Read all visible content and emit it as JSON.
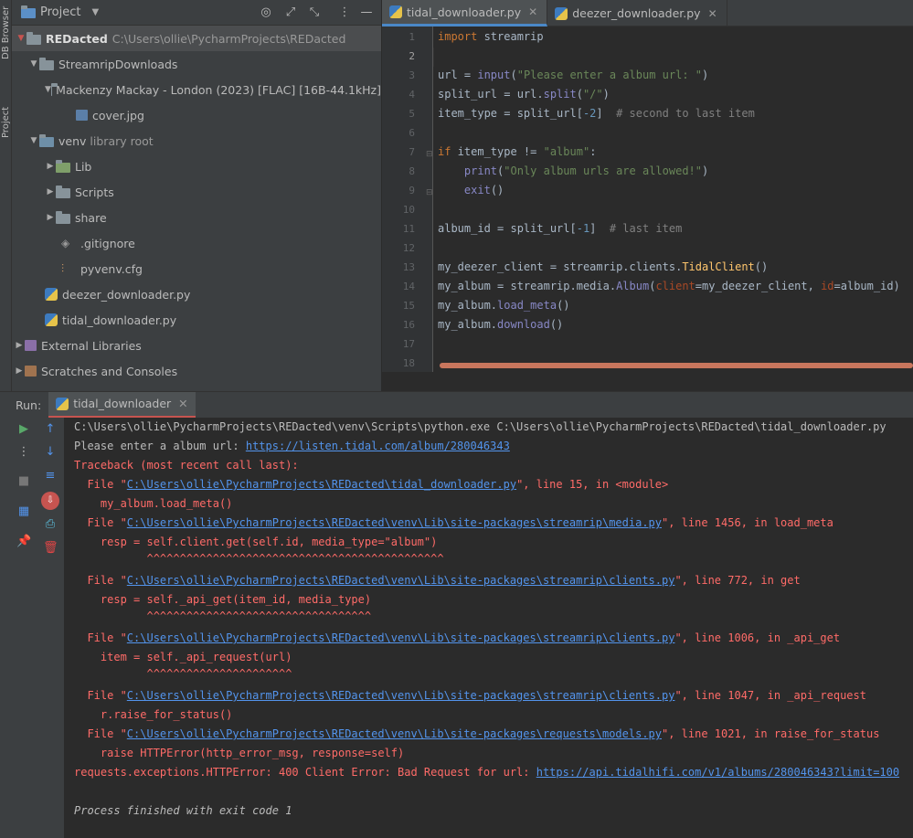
{
  "side_tabs": {
    "db_browser": "DB Browser",
    "project": "Project"
  },
  "project_panel": {
    "title": "Project"
  },
  "tree": {
    "root_name": "REDacted",
    "root_path": "C:\\Users\\ollie\\PycharmProjects\\REDacted",
    "streamrip": "StreamripDownloads",
    "album": "Mackenzy Mackay - London (2023) [FLAC] [16B-44.1kHz]",
    "cover": "cover.jpg",
    "venv": "venv",
    "venv_note": "library root",
    "lib": "Lib",
    "scripts": "Scripts",
    "share": "share",
    "gitignore": ".gitignore",
    "pyvenv": "pyvenv.cfg",
    "deezer": "deezer_downloader.py",
    "tidal": "tidal_downloader.py",
    "ext": "External Libraries",
    "scratch": "Scratches and Consoles"
  },
  "tabs": {
    "t1": "tidal_downloader.py",
    "t2": "deezer_downloader.py"
  },
  "line_numbers": [
    "1",
    "2",
    "3",
    "4",
    "5",
    "6",
    "7",
    "8",
    "9",
    "10",
    "11",
    "12",
    "13",
    "14",
    "15",
    "16",
    "17",
    "18"
  ],
  "code": {
    "l1a": "import",
    "l1b": " streamrip",
    "l3a": "url = ",
    "l3b": "input",
    "l3c": "(",
    "l3d": "\"Please enter a album url: \"",
    "l3e": ")",
    "l4a": "split_url = url.",
    "l4b": "split",
    "l4c": "(",
    "l4d": "\"/\"",
    "l4e": ")",
    "l5a": "item_type = split_url[",
    "l5b": "-2",
    "l5c": "]  ",
    "l5d": "# second to last item",
    "l7a": "if",
    "l7b": " item_type != ",
    "l7c": "\"album\"",
    "l7d": ":",
    "l8a": "    ",
    "l8b": "print",
    "l8c": "(",
    "l8d": "\"Only album urls are allowed!\"",
    "l8e": ")",
    "l9a": "    ",
    "l9b": "exit",
    "l9c": "()",
    "l11a": "album_id = split_url[",
    "l11b": "-1",
    "l11c": "]  ",
    "l11d": "# last item",
    "l13a": "my_deezer_client = streamrip.clients.",
    "l13b": "TidalClient",
    "l13c": "()",
    "l14a": "my_album = streamrip.media.",
    "l14b": "Album",
    "l14c": "(",
    "l14d": "client",
    "l14e": "=my_deezer_client, ",
    "l14f": "id",
    "l14g": "=album_id)",
    "l15a": "my_album.",
    "l15b": "load_meta",
    "l15c": "()",
    "l16a": "my_album.",
    "l16b": "download",
    "l16c": "()"
  },
  "run": {
    "label": "Run:",
    "tab": "tidal_downloader"
  },
  "console": {
    "c1": "C:\\Users\\ollie\\PycharmProjects\\REDacted\\venv\\Scripts\\python.exe C:\\Users\\ollie\\PycharmProjects\\REDacted\\tidal_downloader.py",
    "c2a": "Please enter a album url: ",
    "c2b": "https://listen.tidal.com/album/280046343",
    "c3": "Traceback (most recent call last):",
    "c4a": "  File \"",
    "c4b": "C:\\Users\\ollie\\PycharmProjects\\REDacted\\tidal_downloader.py",
    "c4c": "\", line 15, in <module>",
    "c5": "    my_album.load_meta()",
    "c6a": "  File \"",
    "c6b": "C:\\Users\\ollie\\PycharmProjects\\REDacted\\venv\\Lib\\site-packages\\streamrip\\media.py",
    "c6c": "\", line 1456, in load_meta",
    "c7": "    resp = self.client.get(self.id, media_type=\"album\")",
    "c8": "           ^^^^^^^^^^^^^^^^^^^^^^^^^^^^^^^^^^^^^^^^^^^^^",
    "c9a": "  File \"",
    "c9b": "C:\\Users\\ollie\\PycharmProjects\\REDacted\\venv\\Lib\\site-packages\\streamrip\\clients.py",
    "c9c": "\", line 772, in get",
    "c10": "    resp = self._api_get(item_id, media_type)",
    "c11": "           ^^^^^^^^^^^^^^^^^^^^^^^^^^^^^^^^^^",
    "c12a": "  File \"",
    "c12b": "C:\\Users\\ollie\\PycharmProjects\\REDacted\\venv\\Lib\\site-packages\\streamrip\\clients.py",
    "c12c": "\", line 1006, in _api_get",
    "c13": "    item = self._api_request(url)",
    "c14": "           ^^^^^^^^^^^^^^^^^^^^^^",
    "c15a": "  File \"",
    "c15b": "C:\\Users\\ollie\\PycharmProjects\\REDacted\\venv\\Lib\\site-packages\\streamrip\\clients.py",
    "c15c": "\", line 1047, in _api_request",
    "c16": "    r.raise_for_status()",
    "c17a": "  File \"",
    "c17b": "C:\\Users\\ollie\\PycharmProjects\\REDacted\\venv\\Lib\\site-packages\\requests\\models.py",
    "c17c": "\", line 1021, in raise_for_status",
    "c18": "    raise HTTPError(http_error_msg, response=self)",
    "c19a": "requests.exceptions.HTTPError: 400 Client Error: Bad Request for url: ",
    "c19b": "https://api.tidalhifi.com/v1/albums/280046343?limit=100",
    "c21": "Process finished with exit code 1"
  },
  "colors": {
    "keyword": "#cc7832",
    "string": "#6a8759",
    "number": "#6897bb",
    "comment": "#808080",
    "error": "#ff6b68",
    "link": "#5394ec",
    "accent": "#c75450"
  }
}
